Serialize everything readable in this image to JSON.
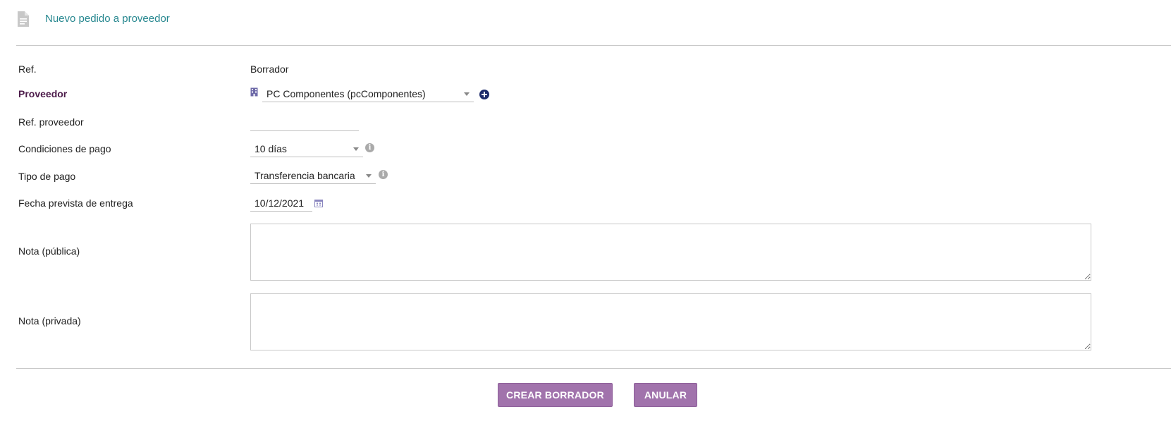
{
  "header": {
    "title": "Nuevo pedido a proveedor",
    "icon": "document-icon"
  },
  "form": {
    "ref": {
      "label": "Ref.",
      "value": "Borrador"
    },
    "proveedor": {
      "label": "Proveedor",
      "value": "PC Componentes (pcComponentes)",
      "icon": "building-icon",
      "add_icon": "plus-circle-icon"
    },
    "ref_proveedor": {
      "label": "Ref. proveedor",
      "value": ""
    },
    "condiciones_pago": {
      "label": "Condiciones de pago",
      "value": "10 días",
      "info_icon": "info-icon"
    },
    "tipo_pago": {
      "label": "Tipo de pago",
      "value": "Transferencia bancaria",
      "info_icon": "info-icon"
    },
    "fecha_entrega": {
      "label": "Fecha prevista de entrega",
      "value": "10/12/2021",
      "icon": "calendar-icon"
    },
    "nota_publica": {
      "label": "Nota (pública)",
      "value": ""
    },
    "nota_privada": {
      "label": "Nota (privada)",
      "value": ""
    }
  },
  "actions": {
    "create_label": "CREAR BORRADOR",
    "cancel_label": "ANULAR"
  },
  "colors": {
    "title": "#26878f",
    "bold_label": "#4c1b4a",
    "button": "#a173ac",
    "add_icon": "#1d2b6b"
  }
}
